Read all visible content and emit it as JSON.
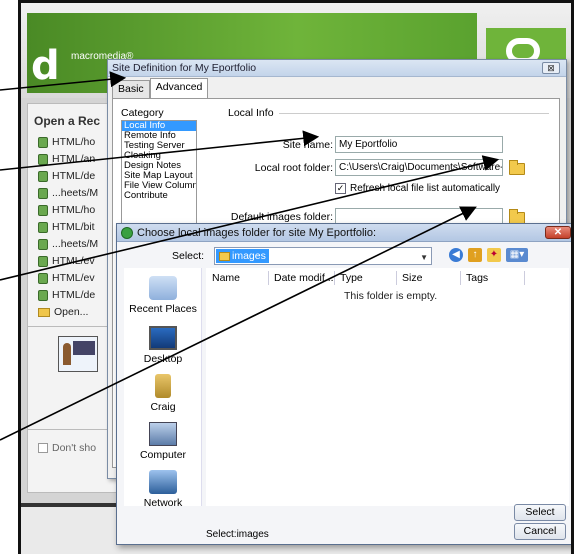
{
  "dreamweaver": {
    "brand": "macromedia®",
    "logo_letter": "d",
    "open_recent_title": "Open a Rec",
    "recent_items": [
      {
        "label": "HTML/ho",
        "kind": "file"
      },
      {
        "label": "HTML/an",
        "kind": "file"
      },
      {
        "label": "HTML/de",
        "kind": "file"
      },
      {
        "label": "...heets/M",
        "kind": "file"
      },
      {
        "label": "HTML/ho",
        "kind": "file"
      },
      {
        "label": "HTML/bit",
        "kind": "file"
      },
      {
        "label": "...heets/M",
        "kind": "file"
      },
      {
        "label": "HTML/ev",
        "kind": "file"
      },
      {
        "label": "HTML/ev",
        "kind": "file"
      },
      {
        "label": "HTML/de",
        "kind": "file"
      },
      {
        "label": "Open...",
        "kind": "folder"
      }
    ],
    "dont_show": "Don't sho"
  },
  "site_definition": {
    "title": "Site Definition for My Eportfolio",
    "close_glyph": "⊠",
    "tabs": [
      {
        "label": "Basic",
        "active": false
      },
      {
        "label": "Advanced",
        "active": true
      }
    ],
    "category_label": "Category",
    "categories": [
      {
        "label": "Local Info",
        "selected": true
      },
      {
        "label": "Remote Info",
        "selected": false
      },
      {
        "label": "Testing Server",
        "selected": false
      },
      {
        "label": "Cloaking",
        "selected": false
      },
      {
        "label": "Design Notes",
        "selected": false
      },
      {
        "label": "Site Map Layout",
        "selected": false
      },
      {
        "label": "File View Columns",
        "selected": false
      },
      {
        "label": "Contribute",
        "selected": false
      }
    ],
    "section_title": "Local Info",
    "site_name_label": "Site name:",
    "site_name_value": "My Eportfolio",
    "local_root_label": "Local root folder:",
    "local_root_value": "C:\\Users\\Craig\\Documents\\Software-tut",
    "refresh_label": "Refresh local file list automatically",
    "refresh_checked": true,
    "default_images_label": "Default images folder:",
    "default_images_value": ""
  },
  "choose_dialog": {
    "title": "Choose local images folder for site My Eportfolio:",
    "close_glyph": "✕",
    "select_label": "Select:",
    "select_value": "images",
    "places": [
      "Recent Places",
      "Desktop",
      "Craig",
      "Computer",
      "Network"
    ],
    "columns": [
      "Name",
      "Date modif...",
      "Type",
      "Size",
      "Tags"
    ],
    "empty_message": "This folder is empty.",
    "status": "Select:images",
    "select_button": "Select",
    "cancel_button": "Cancel"
  },
  "colors": {
    "dw_green": "#6fb43a",
    "selection_blue": "#3399ff",
    "close_red": "#c4412a"
  }
}
